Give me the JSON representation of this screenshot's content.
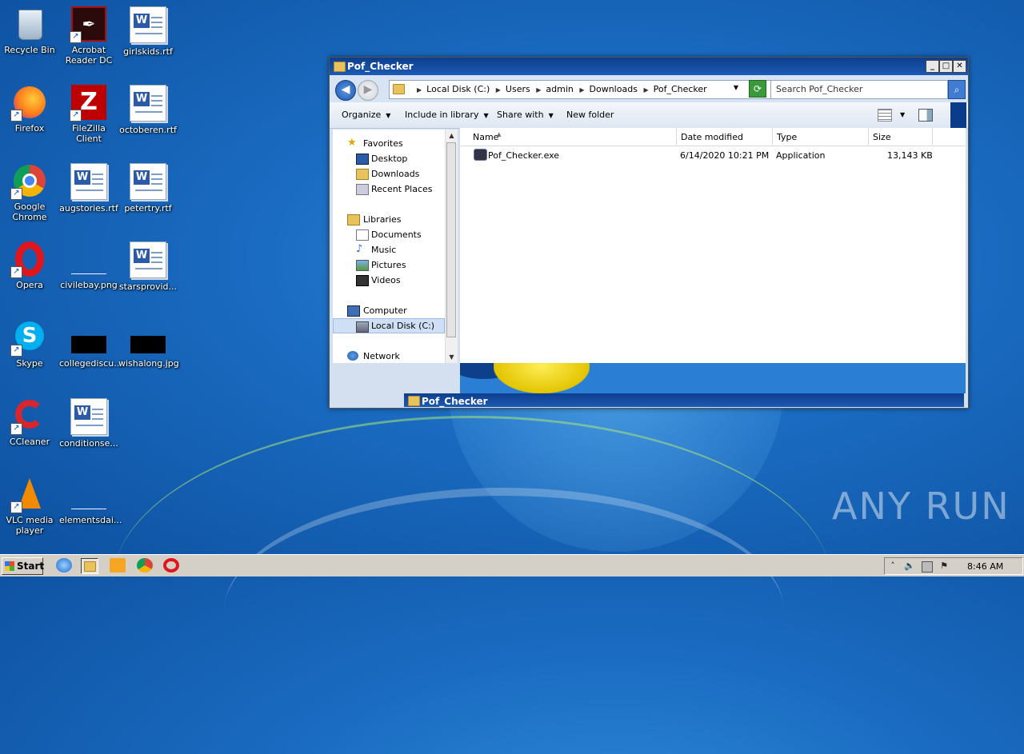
{
  "desktop": {
    "icons": [
      {
        "label": "Recycle Bin"
      },
      {
        "label": "Acrobat Reader DC"
      },
      {
        "label": "girlskids.rtf"
      },
      {
        "label": "Firefox"
      },
      {
        "label": "FileZilla Client"
      },
      {
        "label": "octoberen.rtf"
      },
      {
        "label": "Google Chrome"
      },
      {
        "label": "augstories.rtf"
      },
      {
        "label": "petertry.rtf"
      },
      {
        "label": "Opera"
      },
      {
        "label": "civilebay.png"
      },
      {
        "label": "starsprovid..."
      },
      {
        "label": "Skype"
      },
      {
        "label": "collegediscu..."
      },
      {
        "label": "wishalong.jpg"
      },
      {
        "label": "CCleaner"
      },
      {
        "label": "conditionse..."
      },
      {
        "label": "VLC media player"
      },
      {
        "label": "elementsdai..."
      }
    ]
  },
  "window": {
    "title": "Pof_Checker",
    "controls": {
      "minimize": "_",
      "maximize": "□",
      "close": "✕"
    },
    "breadcrumb": [
      "Local Disk (C:)",
      "Users",
      "admin",
      "Downloads",
      "Pof_Checker"
    ],
    "search_placeholder": "Search Pof_Checker",
    "toolbar": {
      "organize": "Organize",
      "include_in_library": "Include in library",
      "share_with": "Share with",
      "new_folder": "New folder"
    },
    "nav": {
      "favorites": "Favorites",
      "desktop": "Desktop",
      "downloads": "Downloads",
      "recent_places": "Recent Places",
      "libraries": "Libraries",
      "documents": "Documents",
      "music": "Music",
      "pictures": "Pictures",
      "videos": "Videos",
      "computer": "Computer",
      "local_disk": "Local Disk (C:)",
      "network": "Network"
    },
    "columns": {
      "name": "Name",
      "date_modified": "Date modified",
      "type": "Type",
      "size": "Size"
    },
    "files": [
      {
        "name": "Pof_Checker.exe",
        "date_modified": "6/14/2020 10:21 PM",
        "type": "Application",
        "size": "13,143 KB"
      }
    ],
    "inner_title": "Pof_Checker"
  },
  "taskbar": {
    "start_label": "Start",
    "clock": "8:46 AM"
  },
  "watermark": "ANY RUN"
}
